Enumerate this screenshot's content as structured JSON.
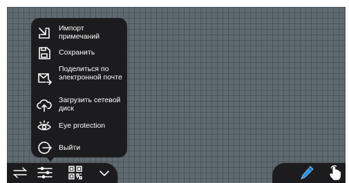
{
  "menu": {
    "items": [
      {
        "icon": "import-icon",
        "label": "Импорт примечаний"
      },
      {
        "icon": "save-icon",
        "label": "Сохранить"
      },
      {
        "icon": "email-share-icon",
        "label": "Поделиться по электронной почте"
      },
      {
        "icon": "cloud-upload-icon",
        "label": "Загрузить сетевой диск"
      },
      {
        "icon": "eye-protection-icon",
        "label": "Eye protection"
      },
      {
        "icon": "exit-icon",
        "label": "Выйти"
      }
    ]
  },
  "toolbar": {
    "left_icons": [
      "swap-arrows-icon",
      "settings-sliders-icon",
      "qr-code-icon",
      "chevron-down-icon"
    ],
    "right_icons": [
      "pen-icon",
      "hand-pointer-icon"
    ]
  },
  "colors": {
    "canvas": "#5f6a70",
    "panel": "#1c1c1e",
    "pen_accent": "#2a8de0"
  }
}
